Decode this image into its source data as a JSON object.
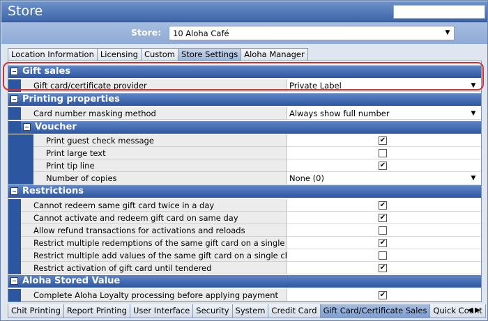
{
  "window": {
    "title": "Store"
  },
  "store_selector": {
    "label": "Store:",
    "value": "10 Aloha Café"
  },
  "top_tabs": [
    {
      "label": "Location Information",
      "active": false
    },
    {
      "label": "Licensing",
      "active": false
    },
    {
      "label": "Custom",
      "active": false
    },
    {
      "label": "Store Settings",
      "active": true
    },
    {
      "label": "Aloha Manager",
      "active": false
    }
  ],
  "sections": {
    "gift_sales": {
      "title": "Gift sales",
      "rows": [
        {
          "name": "Gift card/certificate provider",
          "value": "Private Label",
          "type": "dropdown"
        }
      ]
    },
    "printing_properties": {
      "title": "Printing properties",
      "rows": [
        {
          "name": "Card number masking method",
          "value": "Always show full number",
          "type": "dropdown"
        }
      ],
      "voucher": {
        "title": "Voucher",
        "rows": [
          {
            "name": "Print guest check message",
            "checked": true,
            "type": "checkbox"
          },
          {
            "name": "Print large text",
            "checked": false,
            "type": "checkbox"
          },
          {
            "name": "Print tip line",
            "checked": true,
            "type": "checkbox"
          },
          {
            "name": "Number of copies",
            "value": "None (0)",
            "type": "dropdown"
          }
        ]
      }
    },
    "restrictions": {
      "title": "Restrictions",
      "rows": [
        {
          "name": "Cannot redeem same gift card twice in a day",
          "checked": true
        },
        {
          "name": "Cannot activate and redeem gift card on same day",
          "checked": true
        },
        {
          "name": "Allow refund transactions for activations and reloads",
          "checked": false
        },
        {
          "name": "Restrict multiple redemptions of the same gift card on a single check",
          "checked": true
        },
        {
          "name": "Restrict multiple add values of the same gift card on a single check",
          "checked": false
        },
        {
          "name": "Restrict activation of gift card until tendered",
          "checked": true
        }
      ]
    },
    "aloha_stored_value": {
      "title": "Aloha Stored Value",
      "rows": [
        {
          "name": "Complete Aloha Loyalty processing before applying payment",
          "checked": true
        }
      ]
    }
  },
  "bottom_tabs": [
    {
      "label": "Chit Printing",
      "active": false
    },
    {
      "label": "Report Printing",
      "active": false
    },
    {
      "label": "User Interface",
      "active": false
    },
    {
      "label": "Security",
      "active": false
    },
    {
      "label": "System",
      "active": false
    },
    {
      "label": "Credit Card",
      "active": false
    },
    {
      "label": "Gift Card/Certificate Sales",
      "active": true
    },
    {
      "label": "Quick Count",
      "active": false
    }
  ],
  "icons": {
    "dropdown": "chevron-down-icon",
    "checkmark": "check-icon",
    "collapse": "minus-box-icon"
  },
  "colors": {
    "section_header": "#2d56a0",
    "highlight_border": "#d42e2e",
    "title_bar": "#3c64a8"
  }
}
